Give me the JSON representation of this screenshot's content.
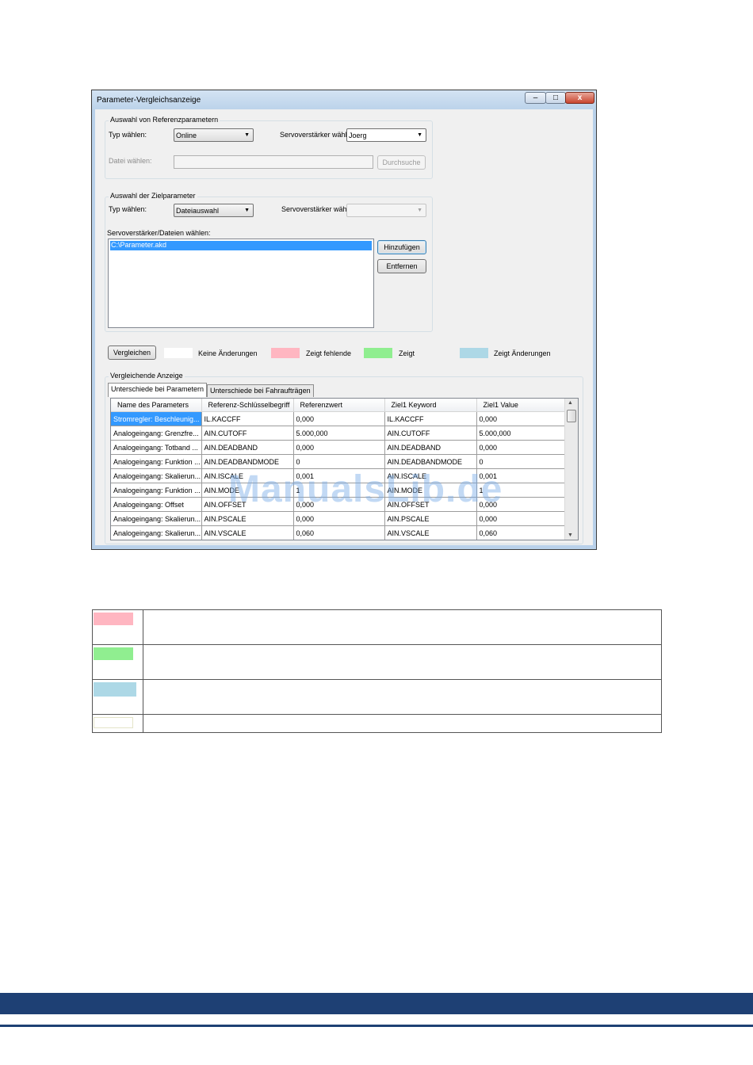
{
  "window": {
    "title": "Parameter-Vergleichsanzeige",
    "minimize_glyph": "–",
    "maximize_glyph": "□",
    "close_glyph": "x"
  },
  "reference": {
    "group_label": "Auswahl von Referenzparametern",
    "type_label": "Typ wählen:",
    "type_value": "Online",
    "servo_label": "Servoverstärker wähl",
    "servo_value": "Joerg",
    "file_label": "Datei wählen:",
    "file_value": "",
    "browse_button": "Durchsuche"
  },
  "target": {
    "group_label": "Auswahl der Zielparameter",
    "type_label": "Typ wählen:",
    "type_value": "Dateiauswahl",
    "servo_label": "Servoverstärker wähl",
    "servo_value": "",
    "files_label": "Servoverstärker/Dateien wählen:",
    "files": [
      "C:\\Parameter.akd"
    ],
    "add_button": "Hinzufügen",
    "remove_button": "Entfernen"
  },
  "legend_bar": {
    "compare_button": "Vergleichen",
    "items": [
      {
        "label": "Keine Änderungen",
        "color": "#ffffff"
      },
      {
        "label": "Zeigt fehlende",
        "color": "#ffb6c1"
      },
      {
        "label": "Zeigt",
        "color": "#90ee90"
      },
      {
        "label": "Zeigt Änderungen",
        "color": "#add8e6"
      }
    ]
  },
  "compare": {
    "group_label": "Vergleichende Anzeige",
    "tabs": [
      "Unterschiede bei Parametern",
      "Unterschiede bei Fahraufträgen"
    ],
    "active_tab": 0,
    "columns": [
      "Name des Parameters",
      "Referenz-Schlüsselbegriff",
      "Referenzwert",
      "Ziel1 Keyword",
      "Ziel1 Value"
    ],
    "rows": [
      [
        "Stromregler: Beschleunig...",
        "IL.KACCFF",
        "0,000",
        "IL.KACCFF",
        "0,000"
      ],
      [
        "Analogeingang: Grenzfre...",
        "AIN.CUTOFF",
        "5.000,000",
        "AIN.CUTOFF",
        "5.000,000"
      ],
      [
        "Analogeingang: Totband ...",
        "AIN.DEADBAND",
        "0,000",
        "AIN.DEADBAND",
        "0,000"
      ],
      [
        "Analogeingang: Funktion ...",
        "AIN.DEADBANDMODE",
        "0",
        "AIN.DEADBANDMODE",
        "0"
      ],
      [
        "Analogeingang: Skalierun...",
        "AIN.ISCALE",
        "0,001",
        "AIN.ISCALE",
        "0,001"
      ],
      [
        "Analogeingang: Funktion ...",
        "AIN.MODE",
        "1",
        "AIN.MODE",
        "1"
      ],
      [
        "Analogeingang: Offset",
        "AIN.OFFSET",
        "0,000",
        "AIN.OFFSET",
        "0,000"
      ],
      [
        "Analogeingang: Skalierun...",
        "AIN.PSCALE",
        "0,000",
        "AIN.PSCALE",
        "0,000"
      ],
      [
        "Analogeingang: Skalierun...",
        "AIN.VSCALE",
        "0,060",
        "AIN.VSCALE",
        "0,060"
      ]
    ],
    "selected_row": 0
  },
  "watermark": "ManualsLib.de",
  "legend_table": [
    {
      "color": "#ffb6c1",
      "text": ""
    },
    {
      "color": "#90ee90",
      "text": ""
    },
    {
      "color": "#add8e6",
      "text": ""
    },
    {
      "color": "#ffffff",
      "text": ""
    }
  ],
  "colors": {
    "footer": "#1e4074",
    "selection": "#3399ff"
  }
}
